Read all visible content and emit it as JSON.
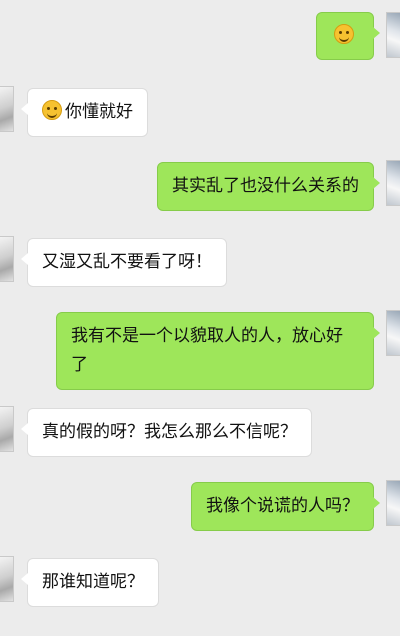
{
  "chat": {
    "messages": [
      {
        "side": "out",
        "emoji": "smirk-emoji",
        "text": ""
      },
      {
        "side": "in",
        "emoji": "grin-emoji",
        "text": "你懂就好"
      },
      {
        "side": "out",
        "text": "其实乱了也没什么关系的"
      },
      {
        "side": "in",
        "text": "又湿又乱不要看了呀！"
      },
      {
        "side": "out",
        "text": "我有不是一个以貌取人的人，放心好了"
      },
      {
        "side": "in",
        "text": "真的假的呀？我怎么那么不信呢？"
      },
      {
        "side": "out",
        "text": "我像个说谎的人吗？"
      },
      {
        "side": "in",
        "text": "那谁知道呢？"
      }
    ]
  },
  "colors": {
    "background": "#ececec",
    "outgoing_bubble": "#9ee65a",
    "incoming_bubble": "#ffffff"
  }
}
